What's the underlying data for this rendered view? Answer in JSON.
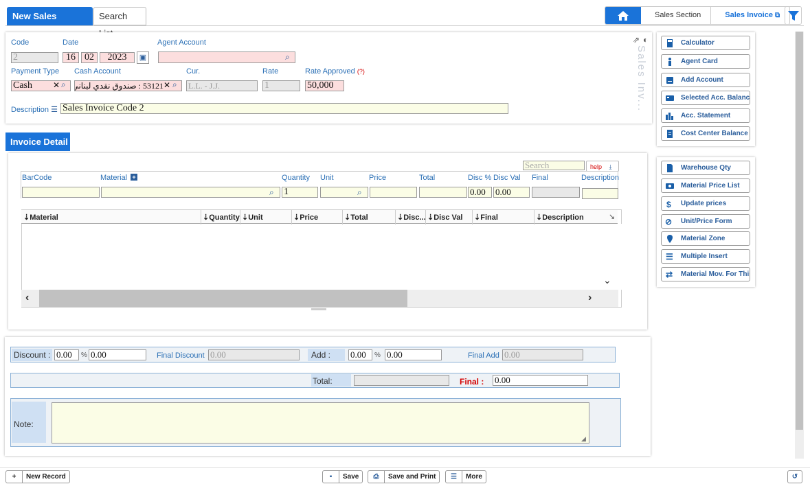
{
  "tabs": [
    {
      "label": "New Sales Invoice"
    },
    {
      "label": "Search List"
    }
  ],
  "breadcrumb": {
    "section": "Sales Section",
    "current": "Sales Invoice"
  },
  "form": {
    "code_label": "Code",
    "code_value": "2",
    "date_label": "Date",
    "date_day": "16",
    "date_month": "02",
    "date_year": "2023",
    "agent_label": "Agent Account",
    "payment_type_label": "Payment Type",
    "payment_type_value": "Cash",
    "cash_account_label": "Cash Account",
    "cash_account_value": "53121 : صندوق نقدي لبناني",
    "cur_label": "Cur.",
    "cur_value": "L.L. - J.J.",
    "rate_label": "Rate",
    "rate_value": "1",
    "rate_approved_label": "Rate Approved",
    "rate_approved_hint": "(?)",
    "rate_approved_value": "50,000",
    "description_label": "Description",
    "description_value": "Sales Invoice Code 2",
    "vertical_caption": "Sales Inv..."
  },
  "side_actions": [
    {
      "label": "Calculator",
      "icon": "calculator-icon"
    },
    {
      "label": "Agent Card",
      "icon": "person-icon"
    },
    {
      "label": "Add Account",
      "icon": "add-account-icon"
    },
    {
      "label": "Selected Acc. Balance",
      "icon": "balance-icon"
    },
    {
      "label": "Acc. Statement",
      "icon": "statement-icon"
    },
    {
      "label": "Cost Center Balance",
      "icon": "cost-center-icon"
    }
  ],
  "material_actions": [
    {
      "label": "Warehouse Qty",
      "icon": "document-icon"
    },
    {
      "label": "Material Price List",
      "icon": "price-list-icon"
    },
    {
      "label": "Update prices",
      "icon": "dollar-icon"
    },
    {
      "label": "Unit/Price Form",
      "icon": "unlink-icon"
    },
    {
      "label": "Material Zone",
      "icon": "location-icon"
    },
    {
      "label": "Multiple Insert",
      "icon": "list-icon"
    },
    {
      "label": "Material Mov. For This",
      "icon": "repeat-icon"
    }
  ],
  "invoice_detail": {
    "tab_label": "Invoice Detail",
    "search_placeholder": "Search",
    "help_label": "help",
    "entry_labels": {
      "barcode": "BarCode",
      "material": "Material",
      "quantity": "Quantity",
      "unit": "Unit",
      "price": "Price",
      "total": "Total",
      "disc_pct": "Disc %",
      "disc_val": "Disc Val",
      "final": "Final",
      "description": "Description"
    },
    "entry_values": {
      "quantity": "1",
      "disc_pct": "0.00",
      "disc_val": "0.00"
    },
    "columns": [
      "Material",
      "Quantity",
      "Unit",
      "Price",
      "Total",
      "Disc...",
      "Disc Val",
      "Final",
      "Description"
    ]
  },
  "summary": {
    "discount_label": "Discount :",
    "discount_pct": "0.00",
    "pct_sign": "%",
    "discount_val": "0.00",
    "final_discount_label": "Final Discount",
    "final_discount_value": "0.00",
    "add_label": "Add :",
    "add_pct": "0.00",
    "add_val": "0.00",
    "final_add_label": "Final Add",
    "final_add_value": "0.00",
    "total_label": "Total:",
    "final_label": "Final :",
    "final_value": "0.00",
    "note_label": "Note:"
  },
  "bottom": {
    "new_record": "New Record",
    "save": "Save",
    "save_print": "Save and Print",
    "more": "More"
  },
  "colors": {
    "accent": "#1a73d9",
    "link": "#2a6fb5",
    "required_bg": "#fcdede",
    "final_red": "#d40000"
  }
}
